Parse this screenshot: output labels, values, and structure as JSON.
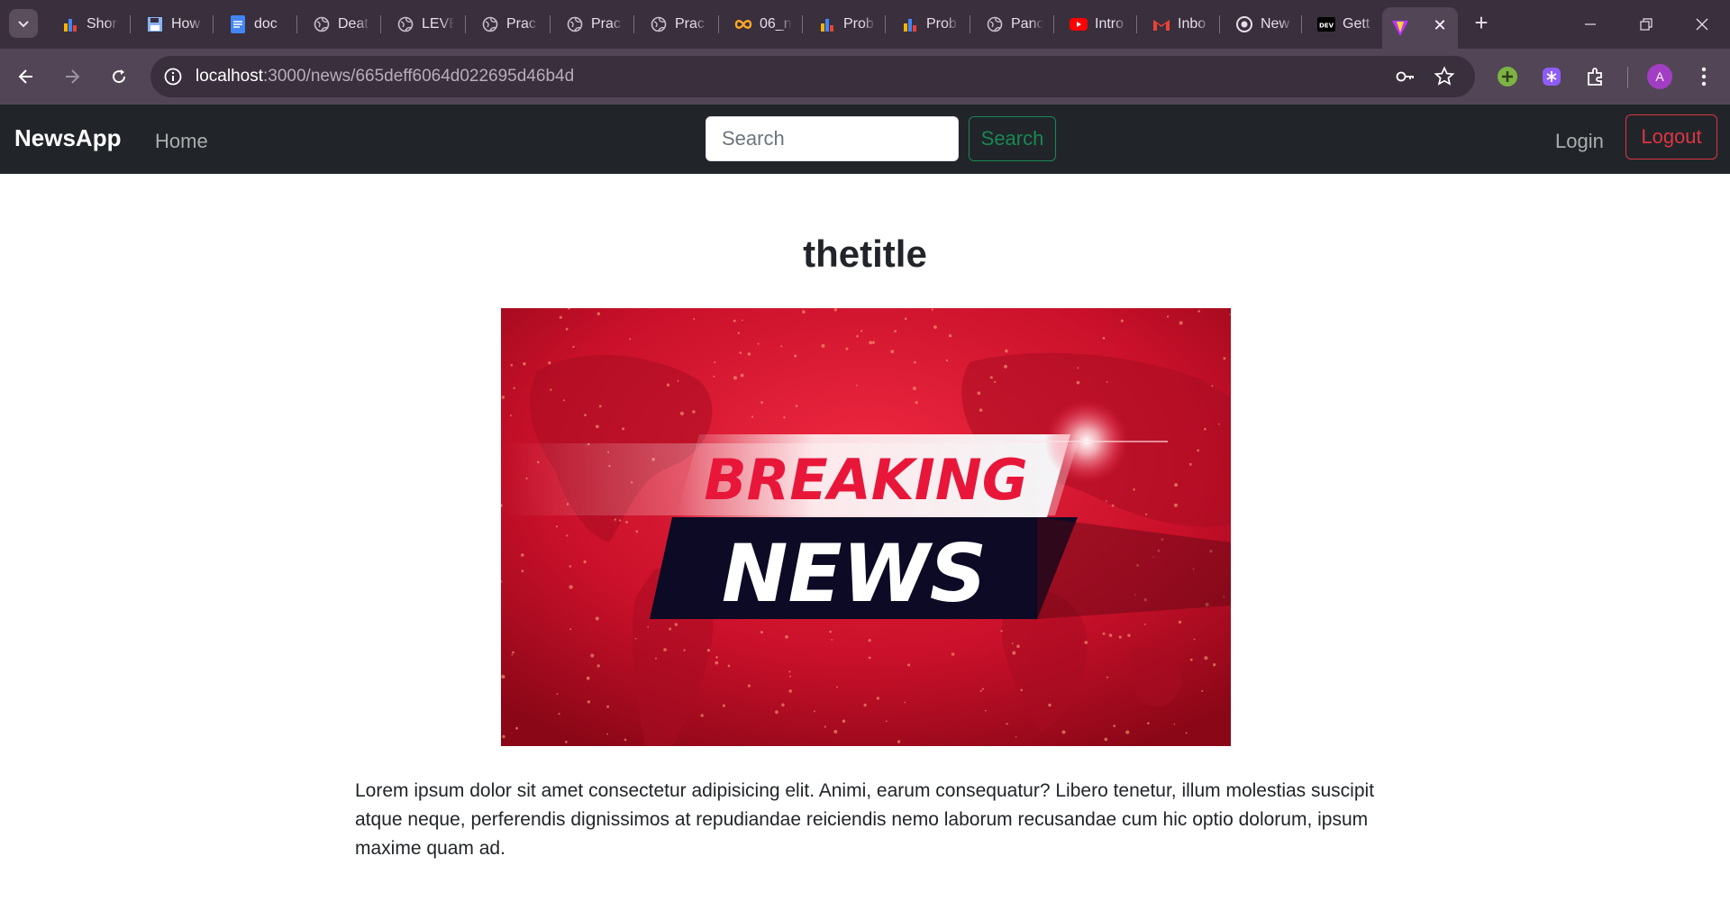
{
  "browser": {
    "tabs": [
      {
        "title": "Shor",
        "icon": "bar-chart-icon",
        "color": "#f4b400"
      },
      {
        "title": "How",
        "icon": "floppy-icon",
        "color": "#8ab4f8"
      },
      {
        "title": "doc",
        "icon": "google-docs-icon",
        "color": "#4285f4"
      },
      {
        "title": "Deat",
        "icon": "globe-icon",
        "color": "#c8c0cb"
      },
      {
        "title": "LEVE",
        "icon": "globe-icon",
        "color": "#c8c0cb"
      },
      {
        "title": "Prac",
        "icon": "globe-icon",
        "color": "#c8c0cb"
      },
      {
        "title": "Prac",
        "icon": "globe-icon",
        "color": "#c8c0cb"
      },
      {
        "title": "Prac",
        "icon": "globe-icon",
        "color": "#c8c0cb"
      },
      {
        "title": "06_n",
        "icon": "infinity-icon",
        "color": "#f9a825"
      },
      {
        "title": "Prob",
        "icon": "bar-chart-icon",
        "color": "#f4b400"
      },
      {
        "title": "Prob",
        "icon": "bar-chart-icon",
        "color": "#f4b400"
      },
      {
        "title": "Panc",
        "icon": "globe-icon",
        "color": "#c8c0cb"
      },
      {
        "title": "Intro",
        "icon": "youtube-icon",
        "color": "#ff0000"
      },
      {
        "title": "Inbo",
        "icon": "gmail-icon",
        "color": "#ea4335"
      },
      {
        "title": "New",
        "icon": "chrome-icon",
        "color": "#e6dfe8"
      },
      {
        "title": "Gett",
        "icon": "dev-icon",
        "color": "#000000"
      }
    ],
    "active_tab_close": "✕",
    "new_tab": "+",
    "url_host": "localhost",
    "url_path": ":3000/news/665deff6064d022695d46b4d",
    "avatar_letter": "A"
  },
  "navbar": {
    "brand": "NewsApp",
    "home": "Home",
    "search_placeholder": "Search",
    "search_button": "Search",
    "login": "Login",
    "logout": "Logout"
  },
  "article": {
    "title": "thetitle",
    "image_text_top": "BREAKING",
    "image_text_bottom": "NEWS",
    "body": "Lorem ipsum dolor sit amet consectetur adipisicing elit. Animi, earum consequatur? Libero tenetur, illum molestias suscipit atque neque, perferendis dignissimos at repudiandae reiciendis nemo laborum recusandae cum hic optio dolorum, ipsum maxime quam ad."
  }
}
